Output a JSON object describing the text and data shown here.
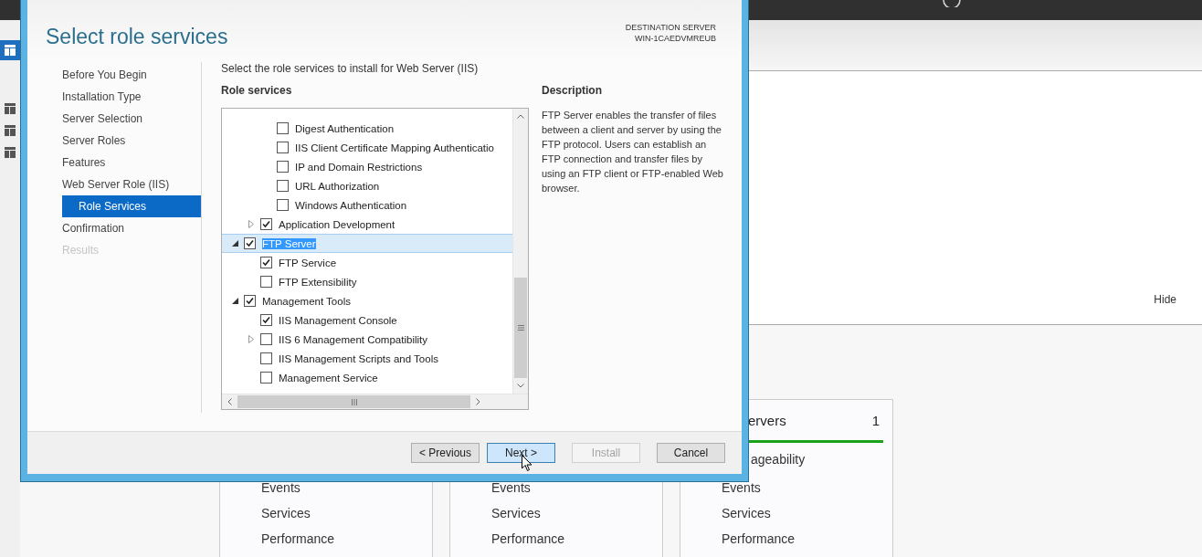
{
  "server_manager": {
    "nav_icons": [
      {
        "selected": true
      },
      {
        "selected": false
      },
      {
        "selected": false
      },
      {
        "selected": false
      }
    ],
    "panel": {
      "hide_link": "Hide"
    },
    "tiles": [
      {
        "lines": [
          "Events",
          "Services",
          "Performance"
        ]
      },
      {
        "lines": [
          "Events",
          "Services",
          "Performance"
        ]
      },
      {
        "title": "ervers",
        "count": "1",
        "status": "ageability",
        "lines": [
          "Events",
          "Services",
          "Performance"
        ]
      }
    ]
  },
  "dialog": {
    "title": "Select role services",
    "destination_label": "DESTINATION SERVER",
    "destination_server": "WIN-1CAEDVMREUB",
    "steps": [
      {
        "label": "Before You Begin",
        "selected": false,
        "disabled": false
      },
      {
        "label": "Installation Type",
        "selected": false,
        "disabled": false
      },
      {
        "label": "Server Selection",
        "selected": false,
        "disabled": false
      },
      {
        "label": "Server Roles",
        "selected": false,
        "disabled": false
      },
      {
        "label": "Features",
        "selected": false,
        "disabled": false
      },
      {
        "label": "Web Server Role (IIS)",
        "selected": false,
        "disabled": false,
        "children": [
          {
            "label": "Role Services",
            "selected": true,
            "disabled": false
          }
        ]
      },
      {
        "label": "Confirmation",
        "selected": false,
        "disabled": false
      },
      {
        "label": "Results",
        "selected": false,
        "disabled": true
      }
    ],
    "instruction": "Select the role services to install for Web Server (IIS)",
    "tree_heading": "Role services",
    "tree": {
      "items": [
        {
          "children": [
            {
              "children": [
                {
                  "label": "Digest Authentication",
                  "checked": false,
                  "selected": false
                },
                {
                  "label": "IIS Client Certificate Mapping Authenticatio",
                  "checked": false,
                  "selected": false
                },
                {
                  "label": "IP and Domain Restrictions",
                  "checked": false,
                  "selected": false
                },
                {
                  "label": "URL Authorization",
                  "checked": false,
                  "selected": false
                },
                {
                  "label": "Windows Authentication",
                  "checked": false,
                  "selected": false
                }
              ]
            },
            {
              "label": "Application Development",
              "checked": true,
              "selected": false,
              "expanded": false
            }
          ]
        },
        {
          "label": "FTP Server",
          "checked": true,
          "selected": true,
          "expanded": true,
          "children": [
            {
              "label": "FTP Service",
              "checked": true,
              "selected": false
            },
            {
              "label": "FTP Extensibility",
              "checked": false,
              "selected": false
            }
          ]
        },
        {
          "label": "Management Tools",
          "checked": true,
          "selected": false,
          "expanded": true,
          "children": [
            {
              "label": "IIS Management Console",
              "checked": true,
              "selected": false
            },
            {
              "label": "IIS 6 Management Compatibility",
              "checked": false,
              "selected": false,
              "expanded": false
            },
            {
              "label": "IIS Management Scripts and Tools",
              "checked": false,
              "selected": false
            },
            {
              "label": "Management Service",
              "checked": false,
              "selected": false
            }
          ]
        }
      ]
    },
    "description_heading": "Description",
    "description": "FTP Server enables the transfer of files between a client and server by using the FTP protocol. Users can establish an FTP connection and transfer files by using an FTP client or FTP-enabled Web browser.",
    "buttons": [
      {
        "label": "< Previous",
        "disabled": false,
        "highlighted": false
      },
      {
        "label": "Next >",
        "disabled": false,
        "highlighted": true
      },
      {
        "label": "Install",
        "disabled": true,
        "highlighted": false
      },
      {
        "label": "Cancel",
        "disabled": false,
        "highlighted": false
      }
    ]
  }
}
